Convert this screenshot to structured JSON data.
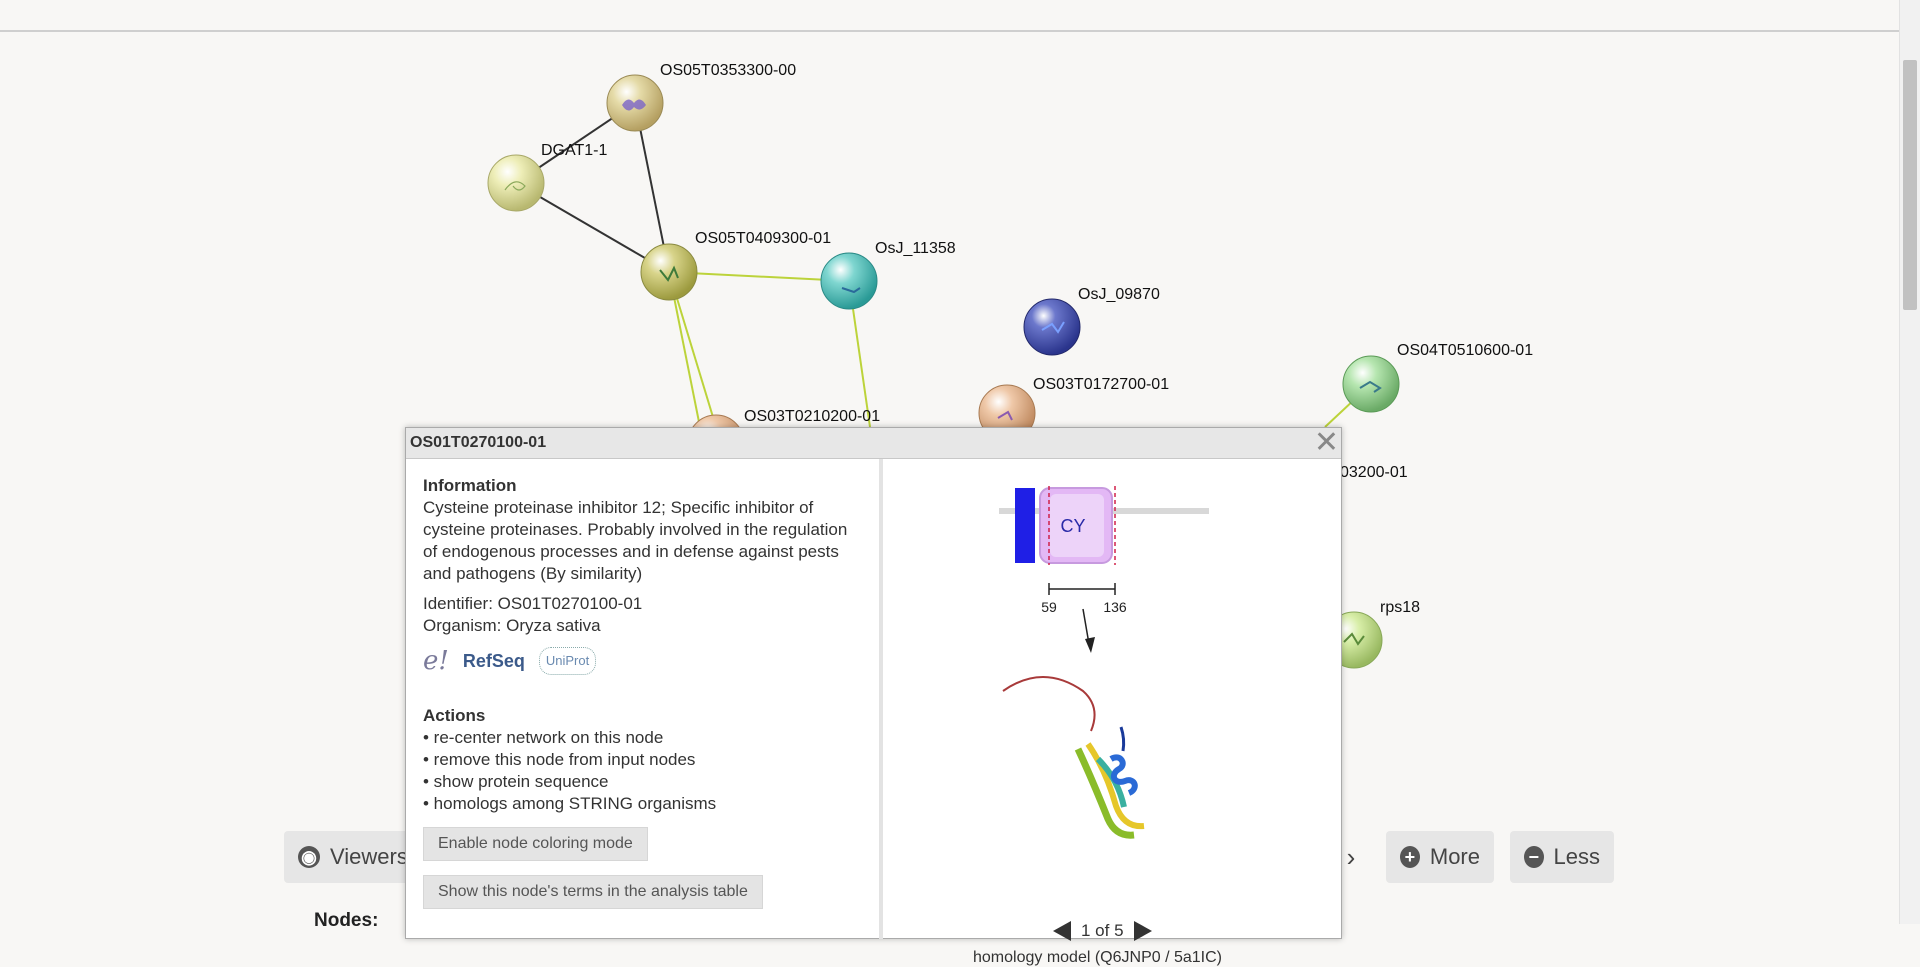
{
  "nodes": [
    {
      "id": "OS05T0353300-00",
      "label": "OS05T0353300-00"
    },
    {
      "id": "DGAT1-1",
      "label": "DGAT1-1"
    },
    {
      "id": "OS05T0409300-01",
      "label": "OS05T0409300-01"
    },
    {
      "id": "OsJ_11358",
      "label": "OsJ_11358"
    },
    {
      "id": "OsJ_09870",
      "label": "OsJ_09870"
    },
    {
      "id": "OS03T0172700-01",
      "label": "OS03T0172700-01"
    },
    {
      "id": "OS03T0210200-01",
      "label": "OS03T0210200-01"
    },
    {
      "id": "OS04T0510600-01",
      "label": "OS04T0510600-01"
    },
    {
      "id": "partial-03200",
      "label": "03200-01"
    },
    {
      "id": "rps18",
      "label": "rps18"
    }
  ],
  "toolbar": {
    "viewers_label": "Viewers",
    "more_label": "More",
    "less_label": "Less",
    "nodes_heading": "Nodes:"
  },
  "popup": {
    "title": "OS01T0270100-01",
    "info_heading": "Information",
    "description": "Cysteine proteinase inhibitor 12; Specific inhibitor of cysteine proteinases. Probably involved in the regulation of endogenous processes and in defense against pests and pathogens (By similarity)",
    "identifier": "Identifier: OS01T0270100-01",
    "organism": "Organism: Oryza sativa",
    "logos": {
      "ensembl": "e!",
      "refseq": "RefSeq",
      "uniprot": "UniProt"
    },
    "actions_heading": "Actions",
    "actions": [
      "• re-center network on this node",
      "• remove this node from input nodes",
      "• show protein sequence",
      "• homologs among STRING organisms"
    ],
    "coloring_button": "Enable node coloring mode",
    "terms_button": "Show this node's terms in the analysis table",
    "domain_label": "CY",
    "domain_start": "59",
    "domain_end": "136",
    "pager": "1 of 5",
    "partial_caption": "homology model (Q6JNP0 / 5a1IC)"
  }
}
